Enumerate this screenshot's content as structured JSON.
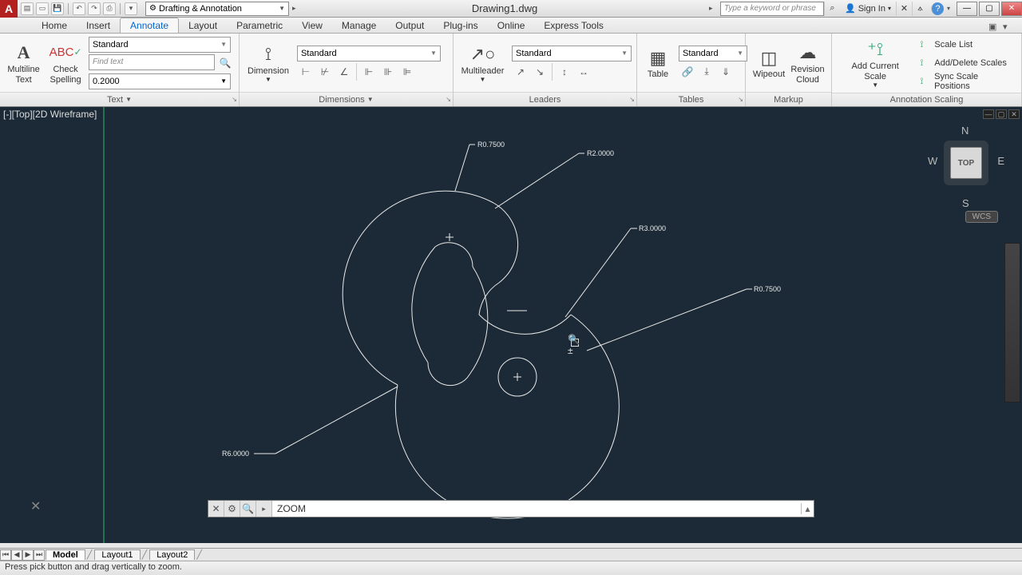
{
  "title": "Drawing1.dwg",
  "workspace": "Drafting & Annotation",
  "search_placeholder": "Type a keyword or phrase",
  "signin": "Sign In",
  "tabs": [
    "Home",
    "Insert",
    "Annotate",
    "Layout",
    "Parametric",
    "View",
    "Manage",
    "Output",
    "Plug-ins",
    "Online",
    "Express Tools"
  ],
  "active_tab": "Annotate",
  "ribbon": {
    "text_panel": {
      "label": "Text",
      "multiline": "Multiline\nText",
      "check": "Check\nSpelling",
      "style": "Standard",
      "find_placeholder": "Find text",
      "height": "0.2000"
    },
    "dim_panel": {
      "label": "Dimensions",
      "big": "Dimension",
      "style": "Standard"
    },
    "lead_panel": {
      "label": "Leaders",
      "big": "Multileader",
      "style": "Standard"
    },
    "table_panel": {
      "label": "Tables",
      "big": "Table",
      "style": "Standard"
    },
    "markup_panel": {
      "label": "Markup",
      "wipeout": "Wipeout",
      "cloud": "Revision\nCloud"
    },
    "scale_panel": {
      "label": "Annotation Scaling",
      "add": "Add Current Scale",
      "l1": "Scale List",
      "l2": "Add/Delete Scales",
      "l3": "Sync Scale Positions"
    }
  },
  "view_label": "[-][Top][2D Wireframe]",
  "viewcube": {
    "top": "TOP",
    "n": "N",
    "s": "S",
    "e": "E",
    "w": "W"
  },
  "wcs": "WCS",
  "dims": {
    "d1": "R0.7500",
    "d2": "R2.0000",
    "d3": "R3.0000",
    "d4": "R0.7500",
    "d5": "R6.0000"
  },
  "command": "ZOOM",
  "model_tabs": [
    "Model",
    "Layout1",
    "Layout2"
  ],
  "status": "Press pick button and drag vertically to zoom."
}
